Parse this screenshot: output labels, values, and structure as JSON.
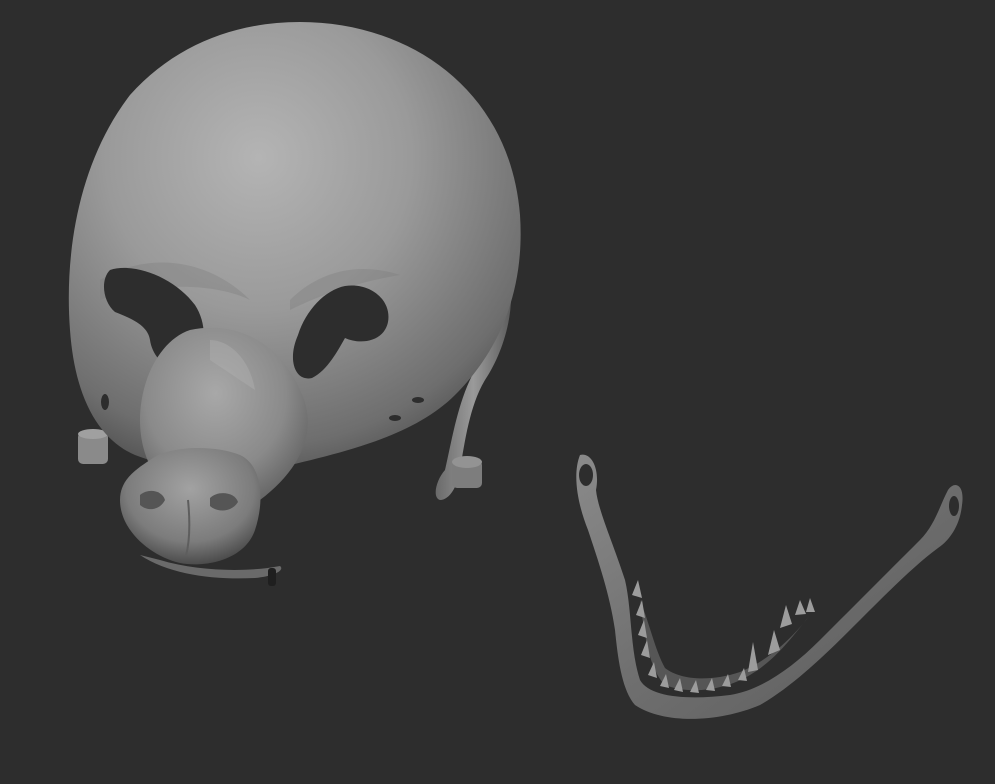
{
  "scene": {
    "background_color": "#2d2d2d",
    "material_color": "#8c8c8c",
    "objects": [
      "dog-mask-head",
      "lower-jaw-piece"
    ]
  }
}
